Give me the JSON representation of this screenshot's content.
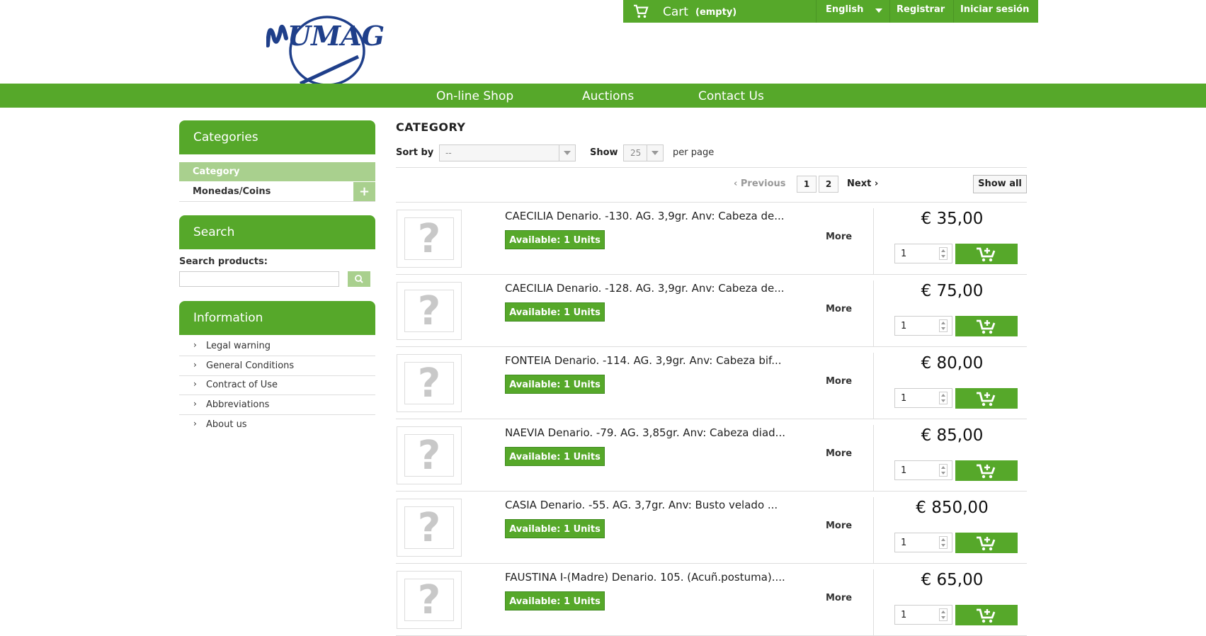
{
  "topbar": {
    "cart_label": "Cart",
    "cart_status": "(empty)",
    "language": "English",
    "register": "Registrar",
    "login": "Iniciar sesión"
  },
  "logo": {
    "text": "NUMAG"
  },
  "nav": [
    "On-line Shop",
    "Auctions",
    "Contact Us"
  ],
  "sidebar": {
    "categories_title": "Categories",
    "categories": [
      {
        "label": "Category",
        "active": true
      },
      {
        "label": "Monedas/Coins",
        "expand": "+"
      }
    ],
    "search_title": "Search",
    "search_label": "Search products:",
    "search_placeholder": "",
    "information_title": "Information",
    "information_items": [
      "Legal warning",
      "General Conditions",
      "Contract of Use",
      "Abbreviations",
      "About us"
    ]
  },
  "listing": {
    "title": "CATEGORY",
    "sort_label": "Sort by",
    "sort_value": "--",
    "show_label": "Show",
    "show_value": "25",
    "per_page": "per page",
    "prev": "Previous",
    "pages": [
      "1",
      "2"
    ],
    "next": "Next",
    "show_all": "Show all",
    "more_label": "More",
    "products": [
      {
        "name": "CAECILIA Denario. -130. AG. 3,9gr. Anv: Cabeza de...",
        "availability": "Available: 1 Units",
        "price": "€ 35,00",
        "qty": "1"
      },
      {
        "name": "CAECILIA Denario. -128. AG. 3,9gr. Anv: Cabeza de...",
        "availability": "Available: 1 Units",
        "price": "€ 75,00",
        "qty": "1"
      },
      {
        "name": "FONTEIA Denario. -114. AG. 3,9gr. Anv: Cabeza bif...",
        "availability": "Available: 1 Units",
        "price": "€ 80,00",
        "qty": "1"
      },
      {
        "name": "NAEVIA Denario. -79. AG. 3,85gr. Anv: Cabeza diad...",
        "availability": "Available: 1 Units",
        "price": "€ 85,00",
        "qty": "1"
      },
      {
        "name": "CASIA Denario. -55. AG. 3,7gr. Anv: Busto velado ...",
        "availability": "Available: 1 Units",
        "price": "€ 850,00",
        "qty": "1"
      },
      {
        "name": "FAUSTINA I-(Madre) Denario. 105. (Acuñ.postuma)....",
        "availability": "Available: 1 Units",
        "price": "€ 65,00",
        "qty": "1"
      }
    ]
  },
  "colors": {
    "brand_green": "#56a82a",
    "light_green": "#a9d08e",
    "logo_blue": "#1f3f8a"
  }
}
